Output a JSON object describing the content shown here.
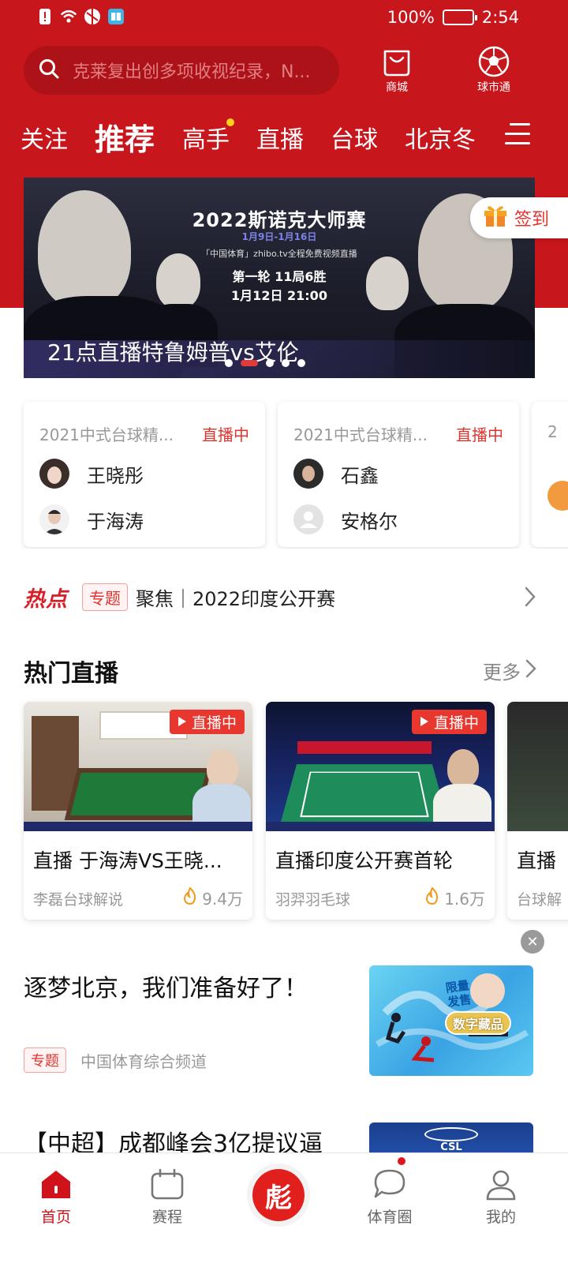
{
  "status_bar": {
    "battery": "100%",
    "time": "2:54"
  },
  "search": {
    "placeholder": "克莱复出创多项收视纪录，N..."
  },
  "header_buttons": {
    "mall": "商城",
    "market": "球市通"
  },
  "tabs": [
    "关注",
    "推荐",
    "高手",
    "直播",
    "台球",
    "北京冬"
  ],
  "active_tab": "推荐",
  "banner": {
    "title": "2022斯诺克大师赛",
    "dates": "1月9日-1月16日",
    "broadcast": "「中国体育」zhibo.tv全程免费视频直播",
    "round": "第一轮  11局6胜",
    "time": "1月12日  21:00",
    "caption": "21点直播特鲁姆普vs艾伦"
  },
  "signin": {
    "label": "签到"
  },
  "matches": [
    {
      "title": "2021中式台球精...",
      "status": "直播中",
      "players": [
        "王晓彤",
        "于海涛"
      ]
    },
    {
      "title": "2021中式台球精...",
      "status": "直播中",
      "players": [
        "石鑫",
        "安格尔"
      ]
    },
    {
      "title": "2",
      "status": "",
      "players": []
    }
  ],
  "hot": {
    "logo": "热点",
    "tag": "专题",
    "text": "聚焦｜2022印度公开赛"
  },
  "hot_live": {
    "title": "热门直播",
    "more": "更多",
    "cards": [
      {
        "badge": "直播中",
        "title": "直播 于海涛VS王晓...",
        "source": "李磊台球解说",
        "heat": "9.4万"
      },
      {
        "badge": "直播中",
        "title": "直播印度公开赛首轮",
        "source": "羽羿羽毛球",
        "heat": "1.6万"
      },
      {
        "badge": "",
        "title": "直播",
        "source": "台球解",
        "heat": ""
      }
    ]
  },
  "article": {
    "title": "逐梦北京，我们准备好了！",
    "tag": "专题",
    "source": "中国体育综合频道",
    "promo_line1": "限量",
    "promo_line2": "发售",
    "promo_label": "数字藏品"
  },
  "article2": {
    "title": "【中超】成都峰会3亿提议逼",
    "logo": "CSL"
  },
  "bottom_nav": [
    {
      "label": "首页"
    },
    {
      "label": "赛程"
    },
    {
      "label": "彪"
    },
    {
      "label": "体育圈"
    },
    {
      "label": "我的"
    }
  ],
  "colors": {
    "brand": "#c8161d",
    "accent": "#e0342f",
    "live_badge": "#e8372f"
  }
}
